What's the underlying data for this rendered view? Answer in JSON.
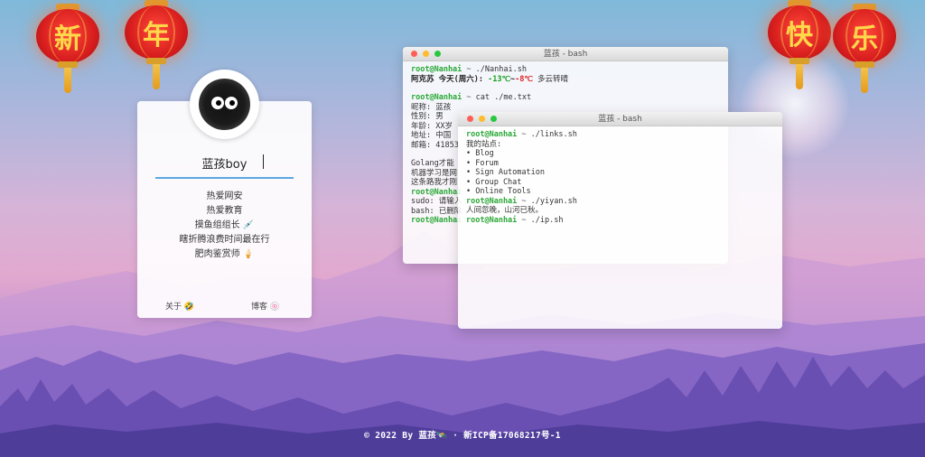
{
  "lanterns": [
    "新",
    "年",
    "快",
    "乐"
  ],
  "profile": {
    "name": "蓝孩boy",
    "tags": [
      "热爱网安",
      "热爱教育",
      "摸鱼组组长 💉",
      "瞎折腾浪费时间最在行",
      "肥肉鉴赏师 🍦"
    ],
    "about_link": "关于 🤣",
    "blog_link": "博客 🍥"
  },
  "terminal1": {
    "title": "蓝孩 - bash",
    "prompt_user": "root@Nanhai",
    "prompt_tilde": "~",
    "cmd1": "./Nanhai.sh",
    "weather_prefix": "阿克苏 今天(周六):",
    "temp_low": "-13℃",
    "temp_sep": "~",
    "temp_high": "-8℃",
    "weather_desc": "多云转晴",
    "cmd2": "cat ./me.txt",
    "info_lines": [
      "昵称: 蓝孩",
      "性别: 男",
      "年龄: XX岁",
      "地址: 中国",
      "邮箱: 41853"
    ],
    "text_lines": [
      "Golang才能",
      "机器学习是网",
      "这条路我才刚"
    ],
    "sudo_line": "sudo: 请输入",
    "bash_line": "bash: 已删除"
  },
  "terminal2": {
    "title": "蓝孩 - bash",
    "cmd1": "./links.sh",
    "sites_label": "我的站点:",
    "links": [
      "• Blog",
      "• Forum",
      "• Sign Automation",
      "• Group Chat",
      "• Online Tools"
    ],
    "cmd2": "./yiyan.sh",
    "quote": "人间忽晚，山河已秋。",
    "cmd3": "./ip.sh"
  },
  "footer": {
    "text": "© 2022 By 蓝孩🛰️ · 新ICP备17068217号-1"
  },
  "colors": {
    "prompt": "#2aa836",
    "temp_high": "#d22222",
    "temp_low": "#18a018",
    "input_underline": "#5aa8e0"
  }
}
